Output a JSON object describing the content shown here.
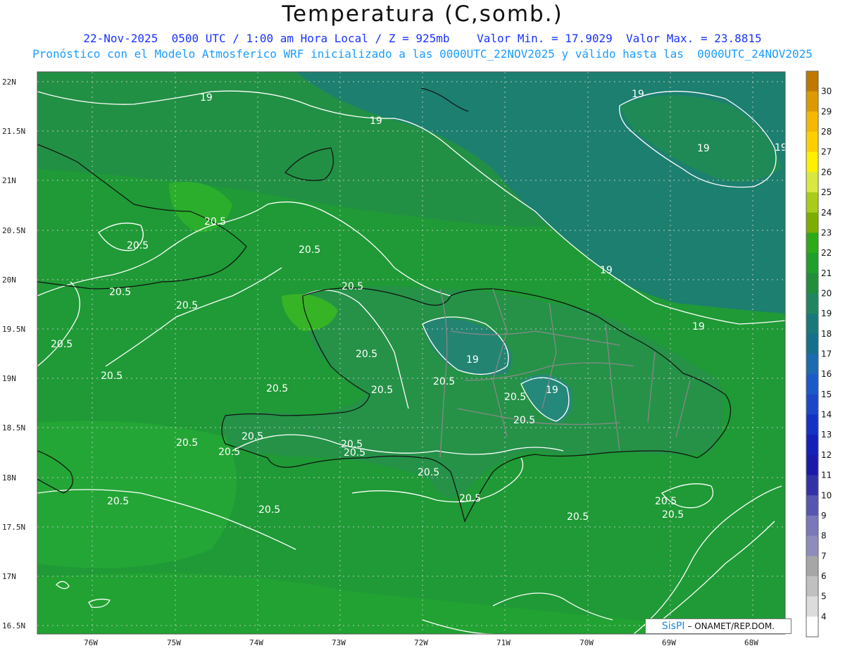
{
  "title": "Temperatura (C,somb.)",
  "subtitle_line1": "22-Nov-2025  0500 UTC / 1:00 am Hora Local / Z = 925mb    Valor Min. = 17.9029  Valor Max. = 23.8815",
  "subtitle_line2": "Pronóstico con el Modelo Atmosferico WRF inicializado a las 0000UTC_22NOV2025 y válido hasta las  0000UTC_24NOV2025",
  "credit": {
    "logo": "SisPI",
    "text": " – ONAMET/REP.DOM."
  },
  "lat_ticks": [
    "22N",
    "21.5N",
    "21N",
    "20.5N",
    "20N",
    "19.5N",
    "19N",
    "18.5N",
    "18N",
    "17.5N",
    "17N",
    "16.5N"
  ],
  "lon_ticks": [
    "76W",
    "75W",
    "74W",
    "73W",
    "72W",
    "71W",
    "70W",
    "69W",
    "68W"
  ],
  "colorbar": {
    "labels": [
      "30",
      "29",
      "28",
      "27",
      "26",
      "25",
      "24",
      "23",
      "22",
      "21",
      "20",
      "19",
      "18",
      "17",
      "16",
      "15",
      "14",
      "13",
      "12",
      "11",
      "10",
      "9",
      "8",
      "7",
      "6",
      "5",
      "4"
    ],
    "colors": [
      "#c07800",
      "#dc9a00",
      "#f5b800",
      "#ffd000",
      "#fff000",
      "#d8e840",
      "#a8cc18",
      "#7cae00",
      "#2caa18",
      "#1ea02a",
      "#228e3a",
      "#208662",
      "#18787a",
      "#16708c",
      "#1c6ab0",
      "#1c5ac8",
      "#1c48c8",
      "#1432c4",
      "#1420b8",
      "#1a1aa8",
      "#3232a8",
      "#5656b0",
      "#7a78b8",
      "#8e8cbc",
      "#a6a6a6",
      "#c0c0c0",
      "#dcdcdc",
      "#ffffff"
    ]
  },
  "contour_labels": [
    "19",
    "19",
    "19",
    "19",
    "19",
    "19",
    "19",
    "19",
    "19",
    "20.5",
    "20.5",
    "20.5",
    "20.5",
    "20.5",
    "20.5",
    "20.5",
    "20.5",
    "20.5",
    "20.5",
    "20.5",
    "20.5",
    "20.5",
    "20.5",
    "20.5",
    "20.5",
    "20.5",
    "20.5",
    "20.5",
    "20.5",
    "20.5",
    "20.5",
    "20.5",
    "20.5",
    "20.5",
    "20.5"
  ],
  "legend_icons": {
    "frame": "map-frame",
    "graticule": "dotted-grid"
  }
}
